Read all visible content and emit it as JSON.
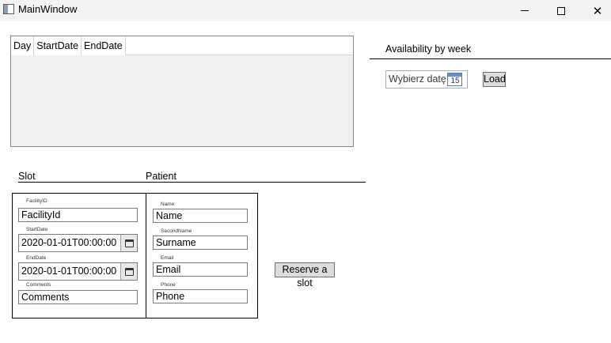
{
  "window": {
    "title": "MainWindow",
    "icon": "app-window-icon",
    "controls": [
      "minimize-icon",
      "maximize-icon",
      "close-icon"
    ],
    "close_glyph": "✕"
  },
  "grid": {
    "columns": [
      "Day",
      "StartDate",
      "EndDate"
    ],
    "rows": []
  },
  "availability": {
    "header": "Availability by week",
    "date_placeholder": "Wybierz datę",
    "calendar_day": "15",
    "load_label": "Load"
  },
  "sections": {
    "slot": "Slot",
    "patient": "Patient"
  },
  "slot": {
    "facility_label": "FacilityID",
    "facility_value": "FacilityId",
    "start_label": "StartDate",
    "start_value": "2020-01-01T00:00:00",
    "end_label": "EndDate",
    "end_value": "2020-01-01T00:00:00",
    "comments_label": "Comments",
    "comments_value": "Comments"
  },
  "patient": {
    "name_label": "Name",
    "name_value": "Name",
    "second_name_label": "SecondName",
    "second_name_value": "Surname",
    "email_label": "Email",
    "email_value": "Email",
    "phone_label": "Phone",
    "phone_value": "Phone"
  },
  "actions": {
    "reserve_label": "Reserve a slot"
  }
}
